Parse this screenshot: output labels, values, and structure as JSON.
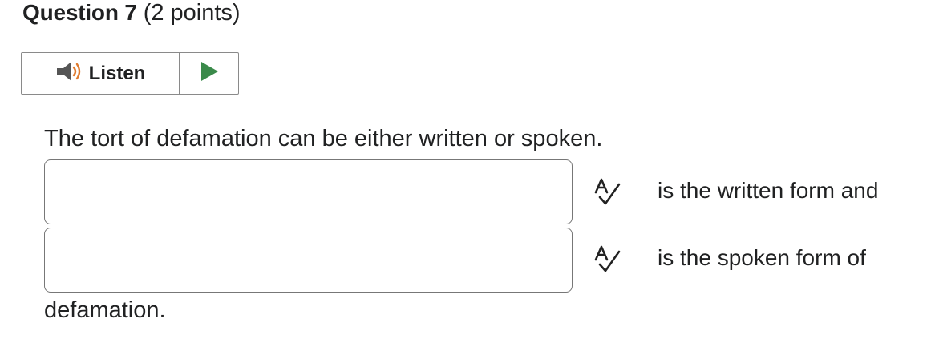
{
  "question": {
    "title": "Question 7",
    "points": "(2 points)"
  },
  "listen": {
    "label": "Listen",
    "speaker_icon": "speaker-icon",
    "play_icon": "play-icon",
    "colors": {
      "speaker": "#555555",
      "waves": "#e07b2e",
      "play": "#3a8a4a"
    }
  },
  "prompt": {
    "text": "The tort of defamation can be either written or spoken."
  },
  "blanks": [
    {
      "value": "",
      "after_text": "is the written form and",
      "icon": "spellcheck-icon"
    },
    {
      "value": "",
      "after_text": "is the spoken form of",
      "icon": "spellcheck-icon"
    }
  ],
  "ending": {
    "text": "defamation."
  }
}
